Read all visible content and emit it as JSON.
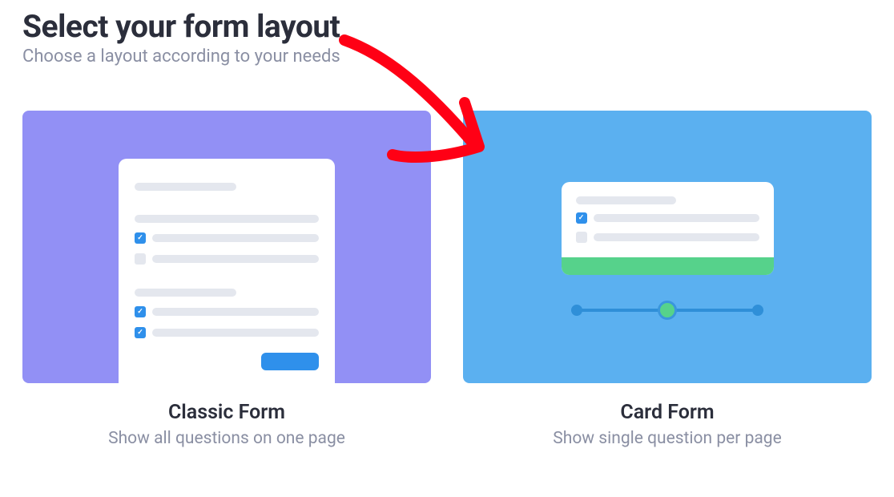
{
  "header": {
    "title": "Select your form layout",
    "subtitle": "Choose a layout according to your needs"
  },
  "options": {
    "classic": {
      "title": "Classic Form",
      "description": "Show all questions on one page"
    },
    "card": {
      "title": "Card Form",
      "description": "Show single question per page"
    }
  }
}
